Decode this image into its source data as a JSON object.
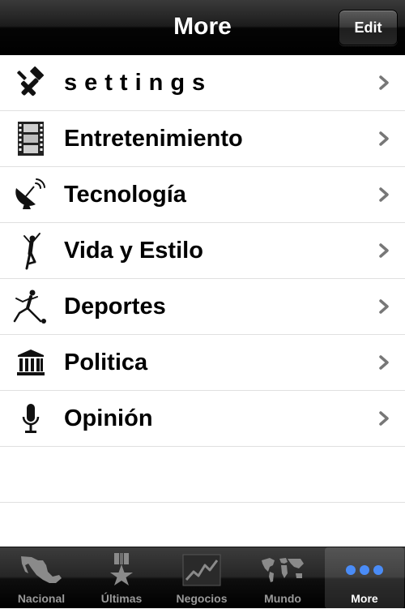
{
  "navbar": {
    "title": "More",
    "edit_label": "Edit"
  },
  "list": {
    "items": [
      {
        "label": "settings",
        "icon": "tools-icon"
      },
      {
        "label": "Entretenimiento",
        "icon": "film-icon"
      },
      {
        "label": "Tecnología",
        "icon": "satellite-dish-icon"
      },
      {
        "label": "Vida y Estilo",
        "icon": "dancer-icon"
      },
      {
        "label": "Deportes",
        "icon": "soccer-player-icon"
      },
      {
        "label": "Politica",
        "icon": "government-building-icon"
      },
      {
        "label": "Opinión",
        "icon": "microphone-icon"
      }
    ]
  },
  "tabbar": {
    "selected": "More",
    "tabs": [
      {
        "label": "Nacional",
        "icon": "mexico-map-icon"
      },
      {
        "label": "Últimas",
        "icon": "medal-star-icon"
      },
      {
        "label": "Negocios",
        "icon": "stock-chart-icon"
      },
      {
        "label": "Mundo",
        "icon": "world-map-icon"
      },
      {
        "label": "More",
        "icon": "more-dots-icon"
      }
    ]
  },
  "colors": {
    "nav_background": "#000000",
    "tab_selected_icon": "#4a8cf7",
    "tab_inactive": "#9a9a9a",
    "separator": "#e0e0e0",
    "chevron": "#777777"
  }
}
